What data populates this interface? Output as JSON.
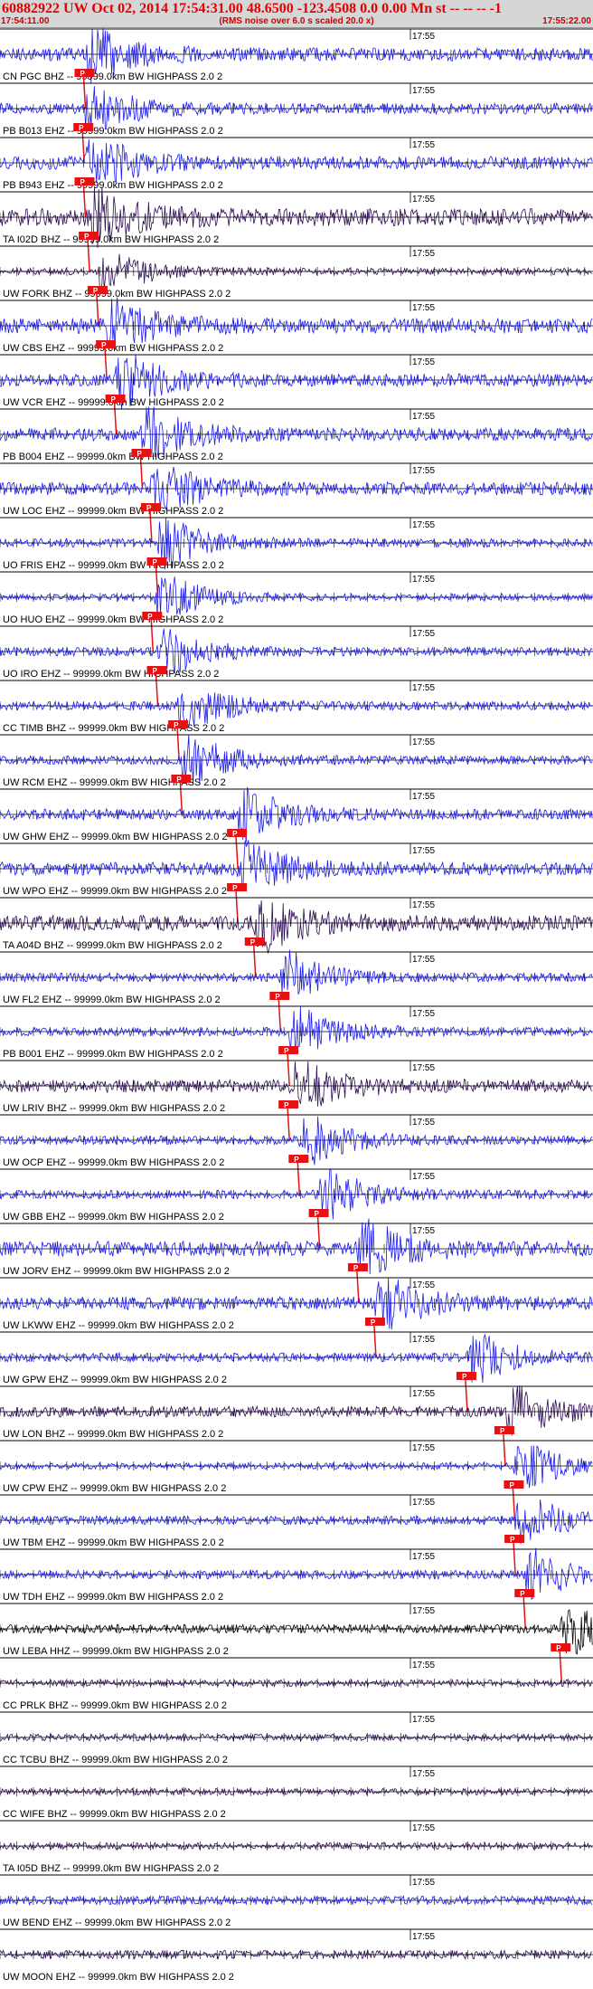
{
  "header": {
    "title": "60882922 UW Oct 02, 2014 17:54:31.00   48.6500 -123.4508  0.0 0.00 Mn st -- -- --  -1",
    "time_start": "17:54:11.00",
    "note": "(RMS noise over 6.0 s scaled 20.0 x)",
    "time_end": "17:55:22.00"
  },
  "chart_data": {
    "type": "line",
    "title": "60882922 UW Oct 02, 2014 17:54:31.00   48.6500 -123.4508  0.0 0.00 Mn st -- -- --  -1",
    "x_range": [
      "17:54:11.00",
      "17:55:22.00"
    ],
    "x_tick_label": "17:55",
    "pick_label": "P",
    "colors": {
      "blue": "#1a1aee",
      "dark": "#2a0a50",
      "black": "#000000",
      "pick": "#e81010"
    },
    "series": [
      {
        "label": "CN PGC BHZ -- 99999.0km BW  HIGHPASS  2.0  2",
        "color": "blue",
        "amp": 0.3,
        "pick": 0.141
      },
      {
        "label": "PB B013 EHZ -- 99999.0km BW  HIGHPASS  2.0  2",
        "color": "blue",
        "amp": 0.25,
        "pick": 0.139
      },
      {
        "label": "PB B943 EHZ -- 99999.0km BW  HIGHPASS  2.0  2",
        "color": "blue",
        "amp": 0.3,
        "pick": 0.141
      },
      {
        "label": "TA I02D BHZ -- 99999.0km BW  HIGHPASS  2.0  2",
        "color": "dark",
        "amp": 0.4,
        "pick": 0.148
      },
      {
        "label": "UW FORK BHZ -- 99999.0km BW  HIGHPASS  2.0  2",
        "color": "dark",
        "amp": 0.15,
        "pick": 0.163
      },
      {
        "label": "UW CBS EHZ -- 99999.0km BW  HIGHPASS  2.0  2",
        "color": "blue",
        "amp": 0.35,
        "pick": 0.177
      },
      {
        "label": "UW VCR EHZ -- 99999.0km BW  HIGHPASS  2.0  2",
        "color": "blue",
        "amp": 0.3,
        "pick": 0.193
      },
      {
        "label": "PB B004 EHZ -- 99999.0km BW  HIGHPASS  2.0  2",
        "color": "blue",
        "amp": 0.3,
        "pick": 0.237
      },
      {
        "label": "UW LOC EHZ -- 99999.0km BW  HIGHPASS  2.0  2",
        "color": "blue",
        "amp": 0.3,
        "pick": 0.253
      },
      {
        "label": "UO FRIS EHZ -- 99999.0km BW  HIGHPASS  2.0  2",
        "color": "blue",
        "amp": 0.2,
        "pick": 0.263
      },
      {
        "label": "UO HUO EHZ -- 99999.0km BW  HIGHPASS  2.0  2",
        "color": "blue",
        "amp": 0.15,
        "pick": 0.255
      },
      {
        "label": "UO IRO EHZ -- 99999.0km BW  HIGHPASS  2.0  2",
        "color": "blue",
        "amp": 0.2,
        "pick": 0.263
      },
      {
        "label": "CC TIMB BHZ -- 99999.0km BW  HIGHPASS  2.0  2",
        "color": "blue",
        "amp": 0.2,
        "pick": 0.299
      },
      {
        "label": "UW RCM EHZ -- 99999.0km BW  HIGHPASS  2.0  2",
        "color": "blue",
        "amp": 0.2,
        "pick": 0.304
      },
      {
        "label": "UW GHW EHZ -- 99999.0km BW  HIGHPASS  2.0  2",
        "color": "blue",
        "amp": 0.25,
        "pick": 0.398
      },
      {
        "label": "UW WPO EHZ -- 99999.0km BW  HIGHPASS  2.0  2",
        "color": "blue",
        "amp": 0.3,
        "pick": 0.398
      },
      {
        "label": "TA A04D BHZ -- 99999.0km BW  HIGHPASS  2.0  2",
        "color": "dark",
        "amp": 0.35,
        "pick": 0.428
      },
      {
        "label": "UW FL2 EHZ -- 99999.0km BW  HIGHPASS  2.0  2",
        "color": "blue",
        "amp": 0.2,
        "pick": 0.47
      },
      {
        "label": "PB B001 EHZ -- 99999.0km BW  HIGHPASS  2.0  2",
        "color": "blue",
        "amp": 0.2,
        "pick": 0.485
      },
      {
        "label": "UW LRIV BHZ -- 99999.0km BW  HIGHPASS  2.0  2",
        "color": "dark",
        "amp": 0.3,
        "pick": 0.485
      },
      {
        "label": "UW OCP EHZ -- 99999.0km BW  HIGHPASS  2.0  2",
        "color": "blue",
        "amp": 0.2,
        "pick": 0.502
      },
      {
        "label": "UW GBB EHZ -- 99999.0km BW  HIGHPASS  2.0  2",
        "color": "blue",
        "amp": 0.2,
        "pick": 0.536
      },
      {
        "label": "UW JORV EHZ -- 99999.0km BW  HIGHPASS  2.0  2",
        "color": "blue",
        "amp": 0.35,
        "pick": 0.602
      },
      {
        "label": "UW LKWW EHZ -- 99999.0km BW  HIGHPASS  2.0  2",
        "color": "blue",
        "amp": 0.3,
        "pick": 0.631
      },
      {
        "label": "UW GPW EHZ -- 99999.0km BW  HIGHPASS  2.0  2",
        "color": "blue",
        "amp": 0.2,
        "pick": 0.785
      },
      {
        "label": "UW LON BHZ -- 99999.0km BW  HIGHPASS  2.0  2",
        "color": "dark",
        "amp": 0.25,
        "pick": 0.849
      },
      {
        "label": "UW CPW EHZ -- 99999.0km BW  HIGHPASS  2.0  2",
        "color": "blue",
        "amp": 0.15,
        "pick": 0.865
      },
      {
        "label": "UW TBM EHZ -- 99999.0km BW  HIGHPASS  2.0  2",
        "color": "blue",
        "amp": 0.2,
        "pick": 0.866
      },
      {
        "label": "UW TDH EHZ -- 99999.0km BW  HIGHPASS  2.0  2",
        "color": "blue",
        "amp": 0.2,
        "pick": 0.883
      },
      {
        "label": "UW LEBA HHZ -- 99999.0km BW  HIGHPASS  2.0  2",
        "color": "black",
        "amp": 0.2,
        "pick": 0.944
      },
      {
        "label": "CC PRLK BHZ -- 99999.0km BW  HIGHPASS  2.0  2",
        "color": "dark",
        "amp": 0.15,
        "pick": null
      },
      {
        "label": "CC TCBU BHZ -- 99999.0km BW  HIGHPASS  2.0  2",
        "color": "dark",
        "amp": 0.15,
        "pick": null
      },
      {
        "label": "CC WIFE BHZ -- 99999.0km BW  HIGHPASS  2.0  2",
        "color": "dark",
        "amp": 0.15,
        "pick": null
      },
      {
        "label": "TA I05D BHZ -- 99999.0km BW  HIGHPASS  2.0  2",
        "color": "dark",
        "amp": 0.15,
        "pick": null
      },
      {
        "label": "UW BEND EHZ -- 99999.0km BW  HIGHPASS  2.0  2",
        "color": "blue",
        "amp": 0.2,
        "pick": null
      },
      {
        "label": "UW MOON EHZ -- 99999.0km BW  HIGHPASS  2.0  2",
        "color": "dark",
        "amp": 0.2,
        "pick": null
      }
    ]
  }
}
